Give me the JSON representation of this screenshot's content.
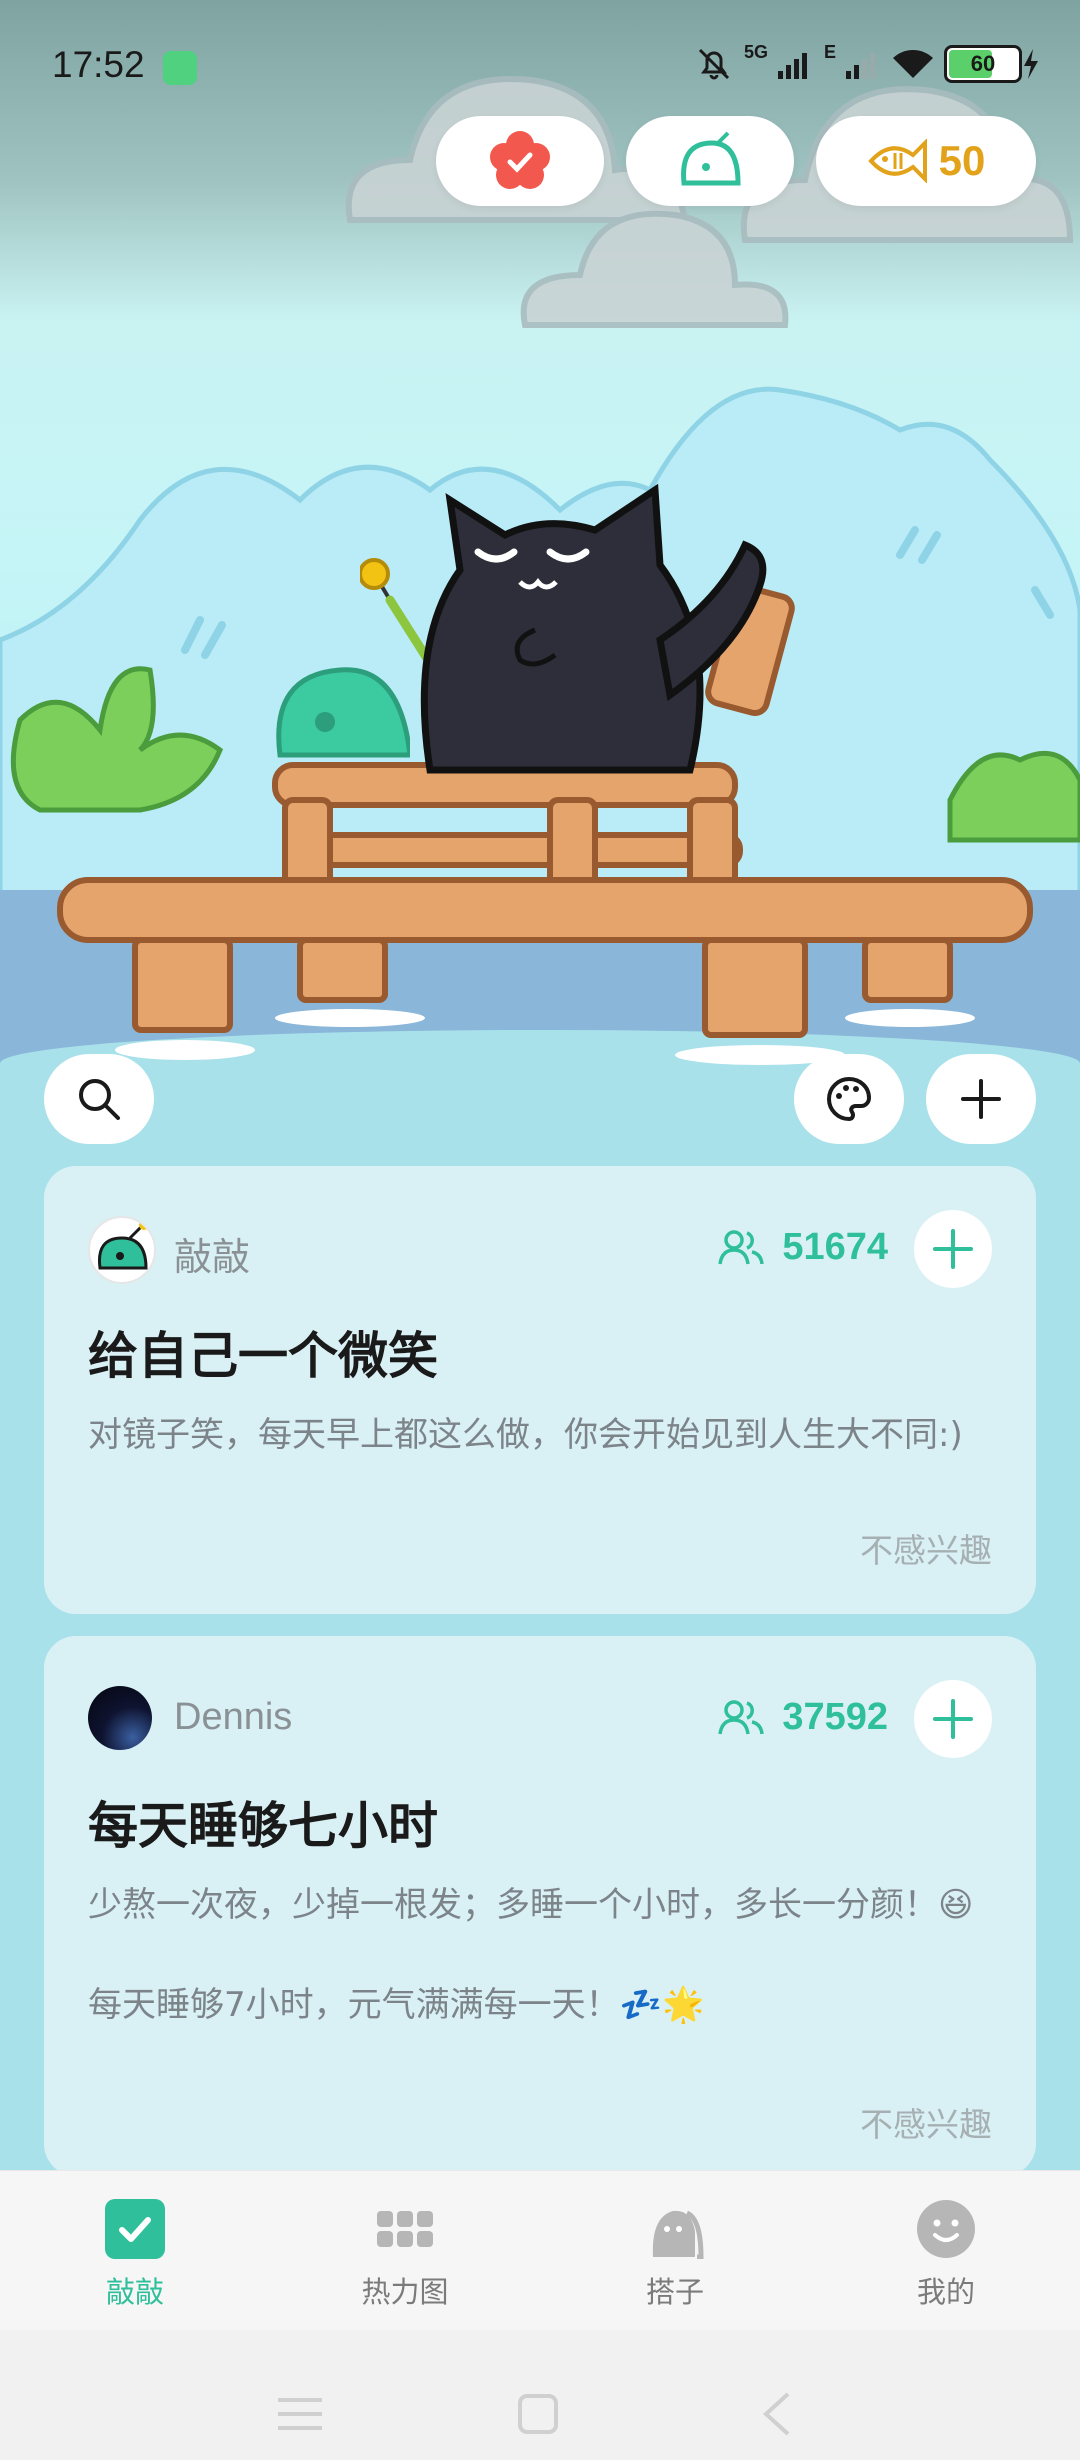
{
  "status_bar": {
    "time": "17:52",
    "signal_1": "5G",
    "signal_2": "E",
    "battery": "60",
    "battery_level": 0.6
  },
  "top_bar": {
    "coins": "50"
  },
  "cards": [
    {
      "author": "敲敲",
      "members": "51674",
      "title": "给自己一个微笑",
      "description": "对镜子笑，每天早上都这么做，你会开始见到人生大不同:)",
      "dismiss": "不感兴趣"
    },
    {
      "author": "Dennis",
      "members": "37592",
      "title": "每天睡够七小时",
      "description": "少熬一次夜，少掉一根发；多睡一个小时，多长一分颜！😆\n\n每天睡够7小时，元气满满每一天！💤🌟",
      "dismiss": "不感兴趣"
    }
  ],
  "nav": {
    "items": [
      {
        "label": "敲敲",
        "icon": "check-icon",
        "active": true
      },
      {
        "label": "热力图",
        "icon": "grid-icon",
        "active": false
      },
      {
        "label": "搭子",
        "icon": "buddy-icon",
        "active": false
      },
      {
        "label": "我的",
        "icon": "smiley-icon",
        "active": false
      }
    ]
  },
  "colors": {
    "accent": "#2fbf9a",
    "coin": "#e2a21a",
    "card_bg": "#d9f1f5"
  }
}
